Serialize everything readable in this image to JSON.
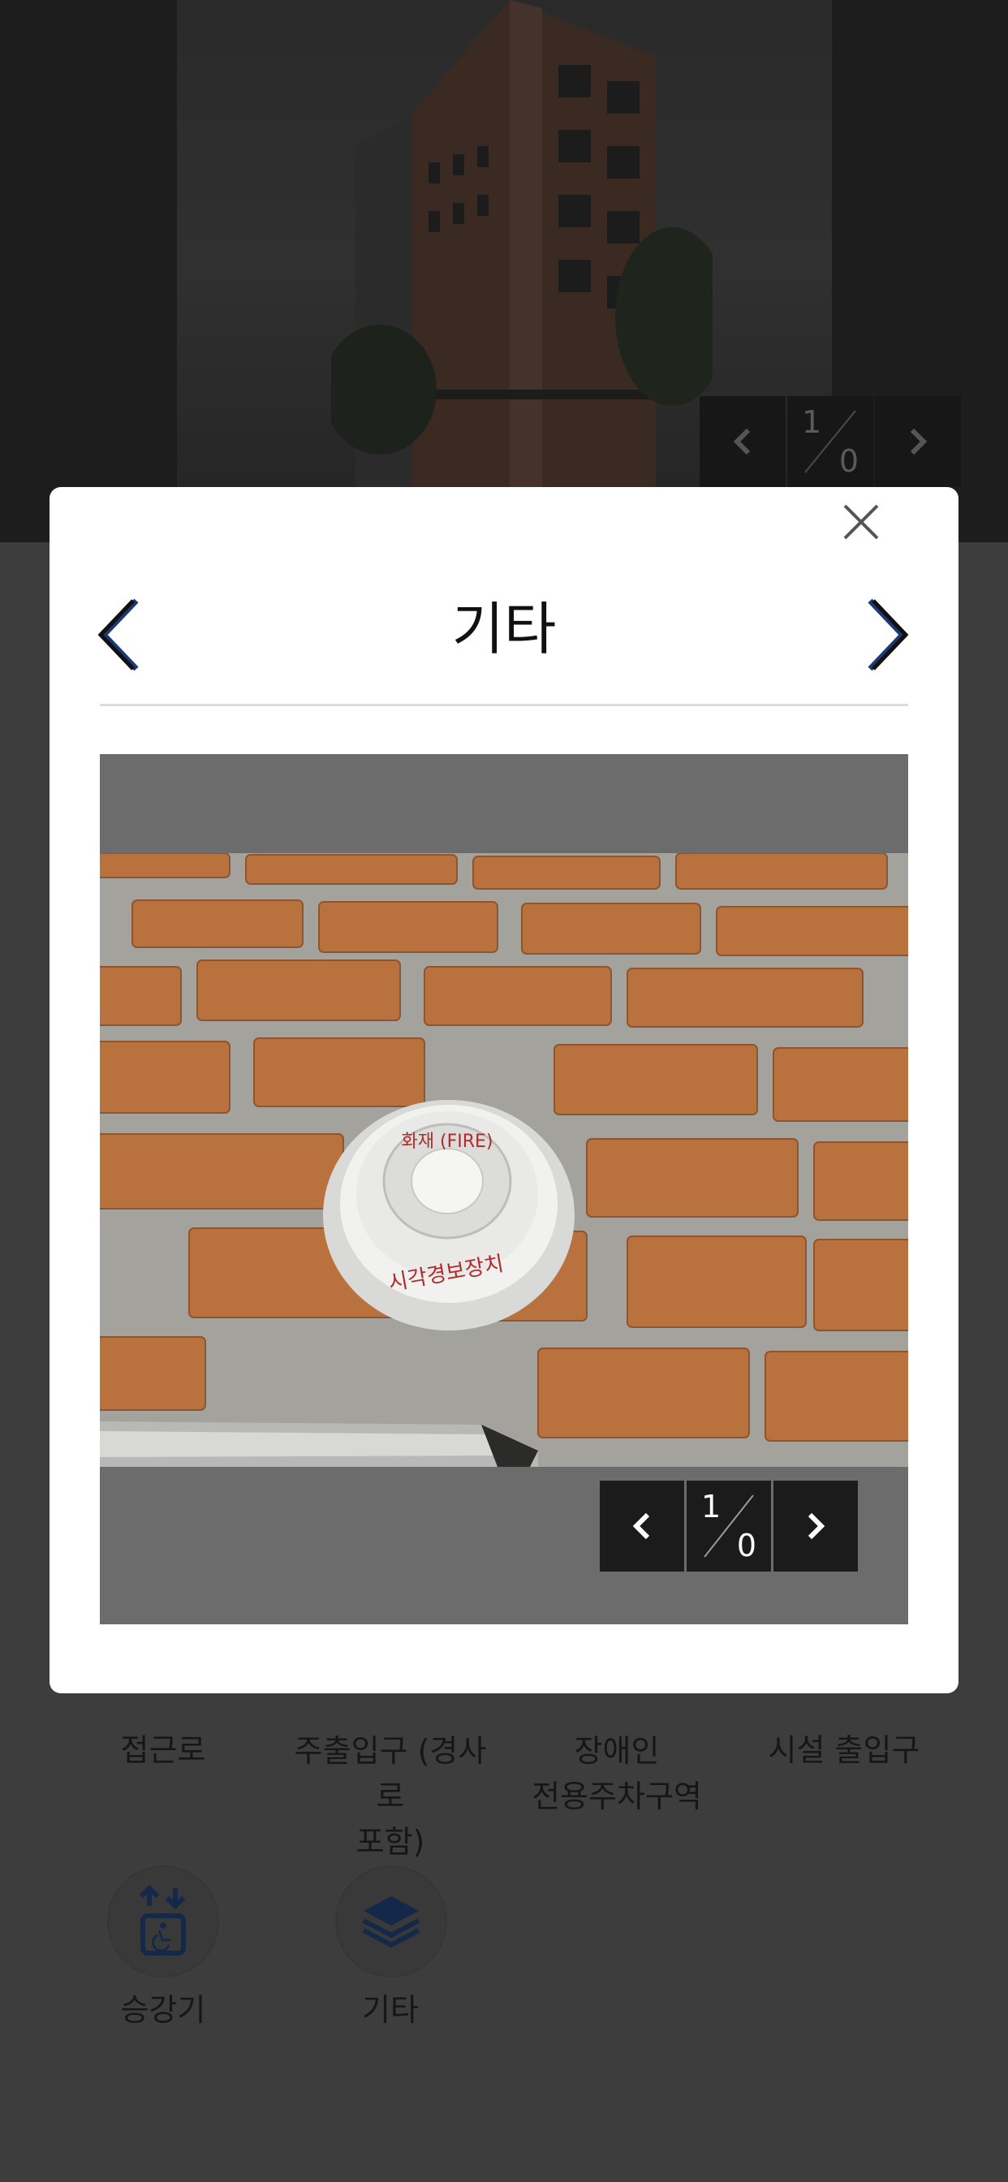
{
  "hero": {
    "counter": {
      "current": "1",
      "total": "0"
    }
  },
  "modal": {
    "title": "기타",
    "viewer": {
      "counter": {
        "current": "1",
        "total": "0"
      }
    },
    "photo_text": {
      "label_top": "화재 (FIRE)",
      "label_bottom": "시각경보장치"
    }
  },
  "categories": [
    {
      "label": "접근로"
    },
    {
      "label": "주출입구 (경사로\n포함)"
    },
    {
      "label": "장애인\n전용주차구역"
    },
    {
      "label": "시설 출입구"
    },
    {
      "label": "승강기"
    },
    {
      "label": "기타"
    }
  ],
  "colors": {
    "overlay": "#3d3d3d",
    "modal_bg": "#ffffff",
    "viewer_bg": "#6c6c6c",
    "accent_icon": "#1e3a6b"
  },
  "icons": [
    "close-icon",
    "chevron-left-icon",
    "chevron-right-icon",
    "elevator-icon",
    "layers-icon"
  ]
}
